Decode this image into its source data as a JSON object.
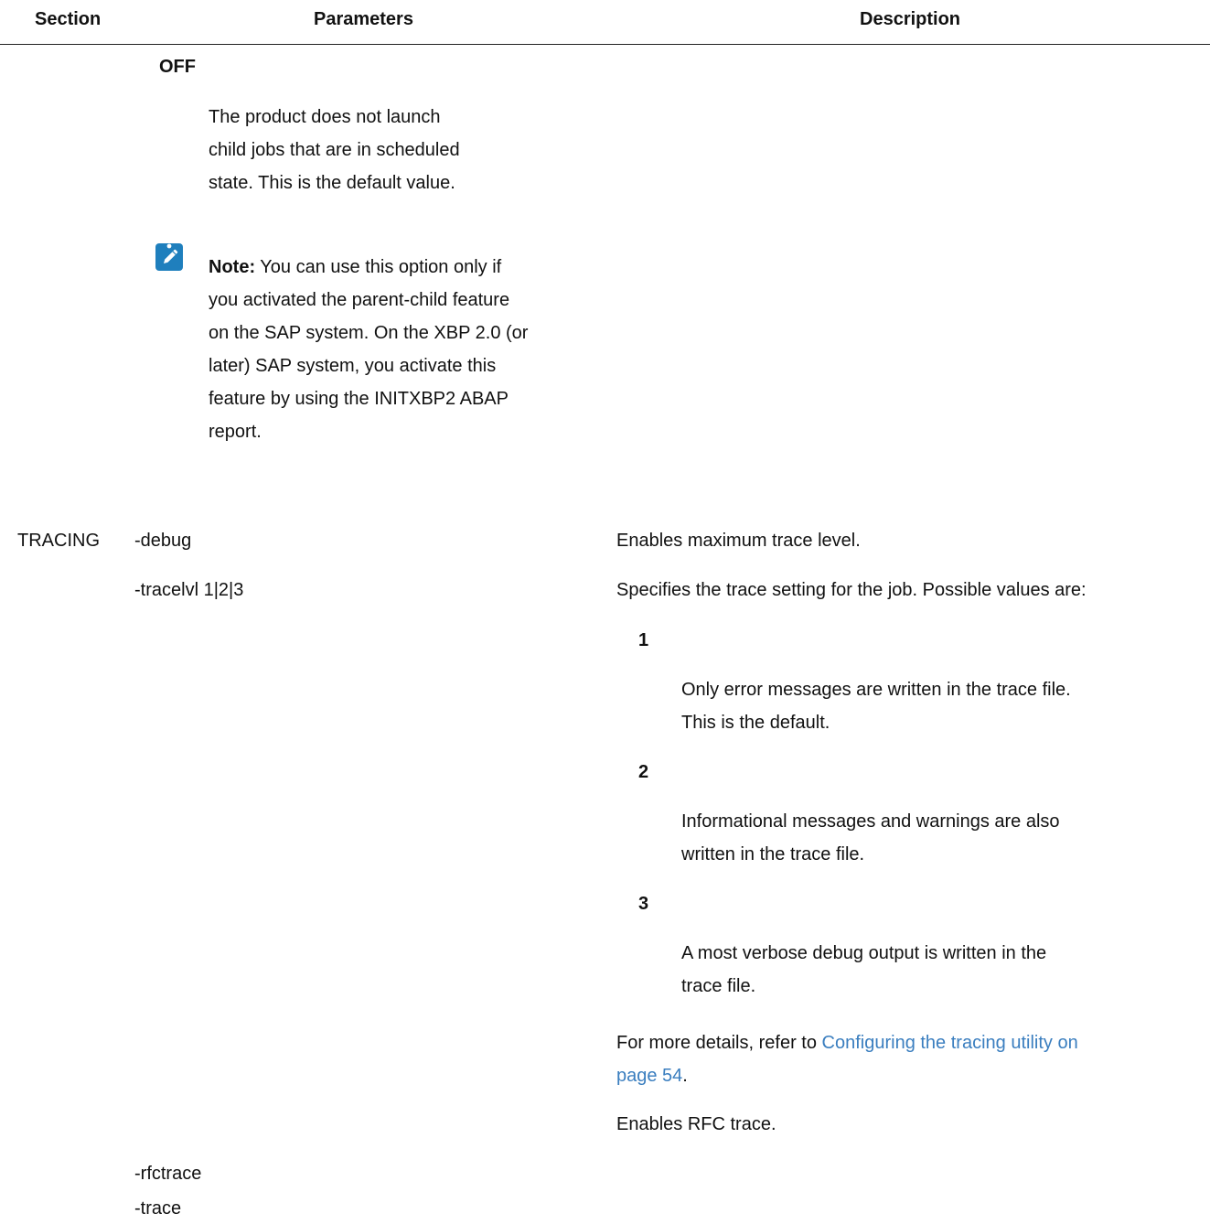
{
  "header": {
    "section": "Section",
    "parameters": "Parameters",
    "description": "Description"
  },
  "off_block": {
    "term": "OFF",
    "desc_lines": [
      "The product does not launch",
      "child jobs that are in scheduled",
      "state. This is the default value."
    ]
  },
  "note": {
    "icon": "pencil-note-icon",
    "label": "Note:",
    "first_line_rest": " You can use this option only if",
    "lines": [
      "you activated the parent-child feature",
      "on the SAP system. On the XBP 2.0 (or",
      "later) SAP system, you activate this",
      "feature by using the INITXBP2 ABAP",
      "report."
    ]
  },
  "tracing": {
    "section": "TRACING",
    "debug_param": "-debug",
    "debug_desc": "Enables maximum trace level.",
    "tracelvl_param": "-tracelvl 1|2|3",
    "tracelvl_desc": "Specifies the trace setting for the job. Possible values are:",
    "levels": [
      {
        "value": "1",
        "lines": [
          "Only error messages are written in the trace file.",
          "This is the default."
        ]
      },
      {
        "value": "2",
        "lines": [
          "Informational messages and warnings are also",
          "written in the trace file."
        ]
      },
      {
        "value": "3",
        "lines": [
          "A most verbose debug output is written in the",
          "trace file."
        ]
      }
    ],
    "more_prefix": "For more details, refer to ",
    "more_link_line1": "Configuring the tracing utility on",
    "more_link_line2": "page 54",
    "more_suffix": ".",
    "rfc_desc": "Enables RFC trace.",
    "rfctrace_param": "-rfctrace",
    "trace_param": "-trace"
  },
  "colors": {
    "link": "#3a7ebf",
    "note_icon_bg": "#1f7fbd",
    "text": "#111111"
  }
}
